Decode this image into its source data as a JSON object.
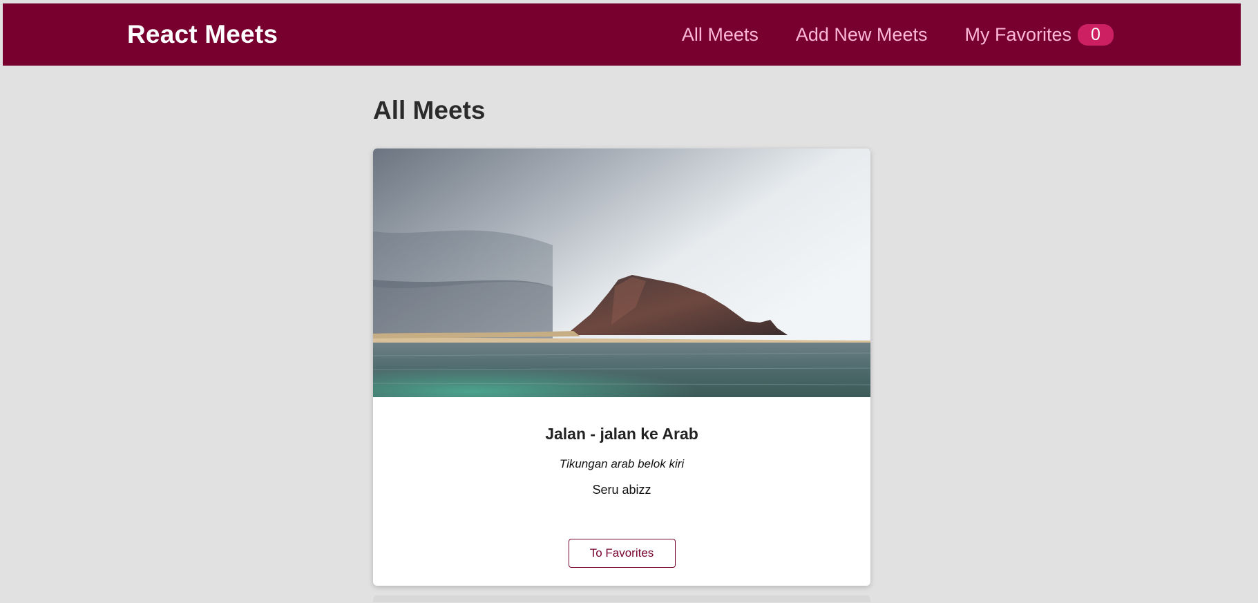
{
  "header": {
    "logo": "React Meets",
    "nav": {
      "all_meets": "All Meets",
      "add_new_meets": "Add New Meets",
      "my_favorites": "My Favorites",
      "favorites_count": "0"
    }
  },
  "main": {
    "page_title": "All Meets",
    "meets": [
      {
        "image_icon": "island-photo",
        "title": "Jalan - jalan ke Arab",
        "address": "Tikungan arab belok kiri",
        "description": "Seru abizz",
        "button_label": "To Favorites"
      }
    ]
  },
  "colors": {
    "header_bg": "#77002e",
    "nav_link": "#fcb8d6",
    "badge_bg": "#cc2062",
    "page_bg": "#e1e1e1",
    "button_border": "#77002e"
  }
}
